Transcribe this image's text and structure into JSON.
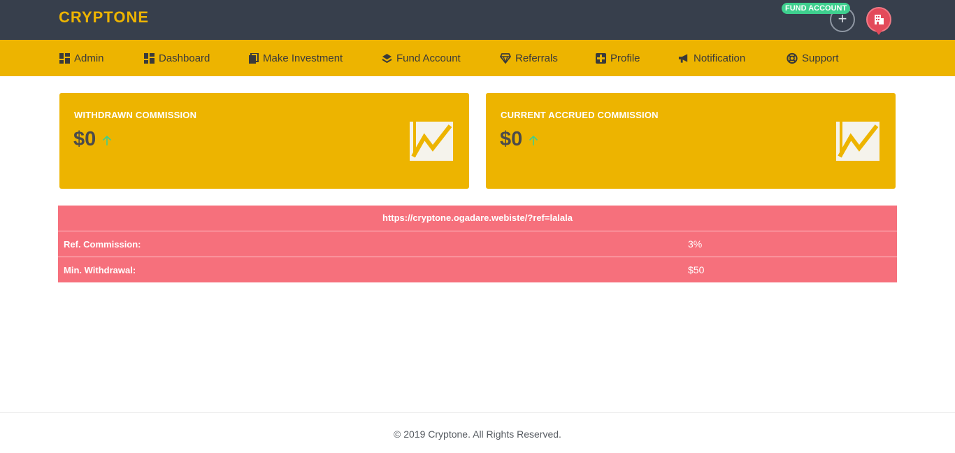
{
  "brand": "CRYPTONE",
  "header": {
    "fund_badge": "FUND ACCOUNT",
    "plus": "+"
  },
  "nav": [
    {
      "label": "Admin",
      "icon": "dashboard-icon"
    },
    {
      "label": "Dashboard",
      "icon": "dashboard-icon"
    },
    {
      "label": "Make Investment",
      "icon": "book-icon"
    },
    {
      "label": "Fund Account",
      "icon": "layers-icon"
    },
    {
      "label": "Referrals",
      "icon": "diamond-icon"
    },
    {
      "label": "Profile",
      "icon": "user-box-icon"
    },
    {
      "label": "Notification",
      "icon": "megaphone-icon"
    },
    {
      "label": "Support",
      "icon": "lifebuoy-icon"
    }
  ],
  "cards": [
    {
      "title": "WITHDRAWN COMMISSION",
      "value": "$0",
      "icon": "chart-line-icon"
    },
    {
      "title": "CURRENT ACCRUED COMMISSION",
      "value": "$0",
      "icon": "chart-line-icon"
    }
  ],
  "referral": {
    "url": "https://cryptone.ogadare.webiste/?ref=lalala",
    "rows": [
      {
        "label": "Ref. Commission:",
        "value": "3%"
      },
      {
        "label": "Min. Withdrawal:",
        "value": "$50"
      }
    ]
  },
  "footer": "© 2019 Cryptone. All Rights Reserved.",
  "colors": {
    "topbar": "#373f4c",
    "accent": "#edb400",
    "table": "#f6707c",
    "badge": "#3ecf8e",
    "avatar": "#e34a5a"
  }
}
